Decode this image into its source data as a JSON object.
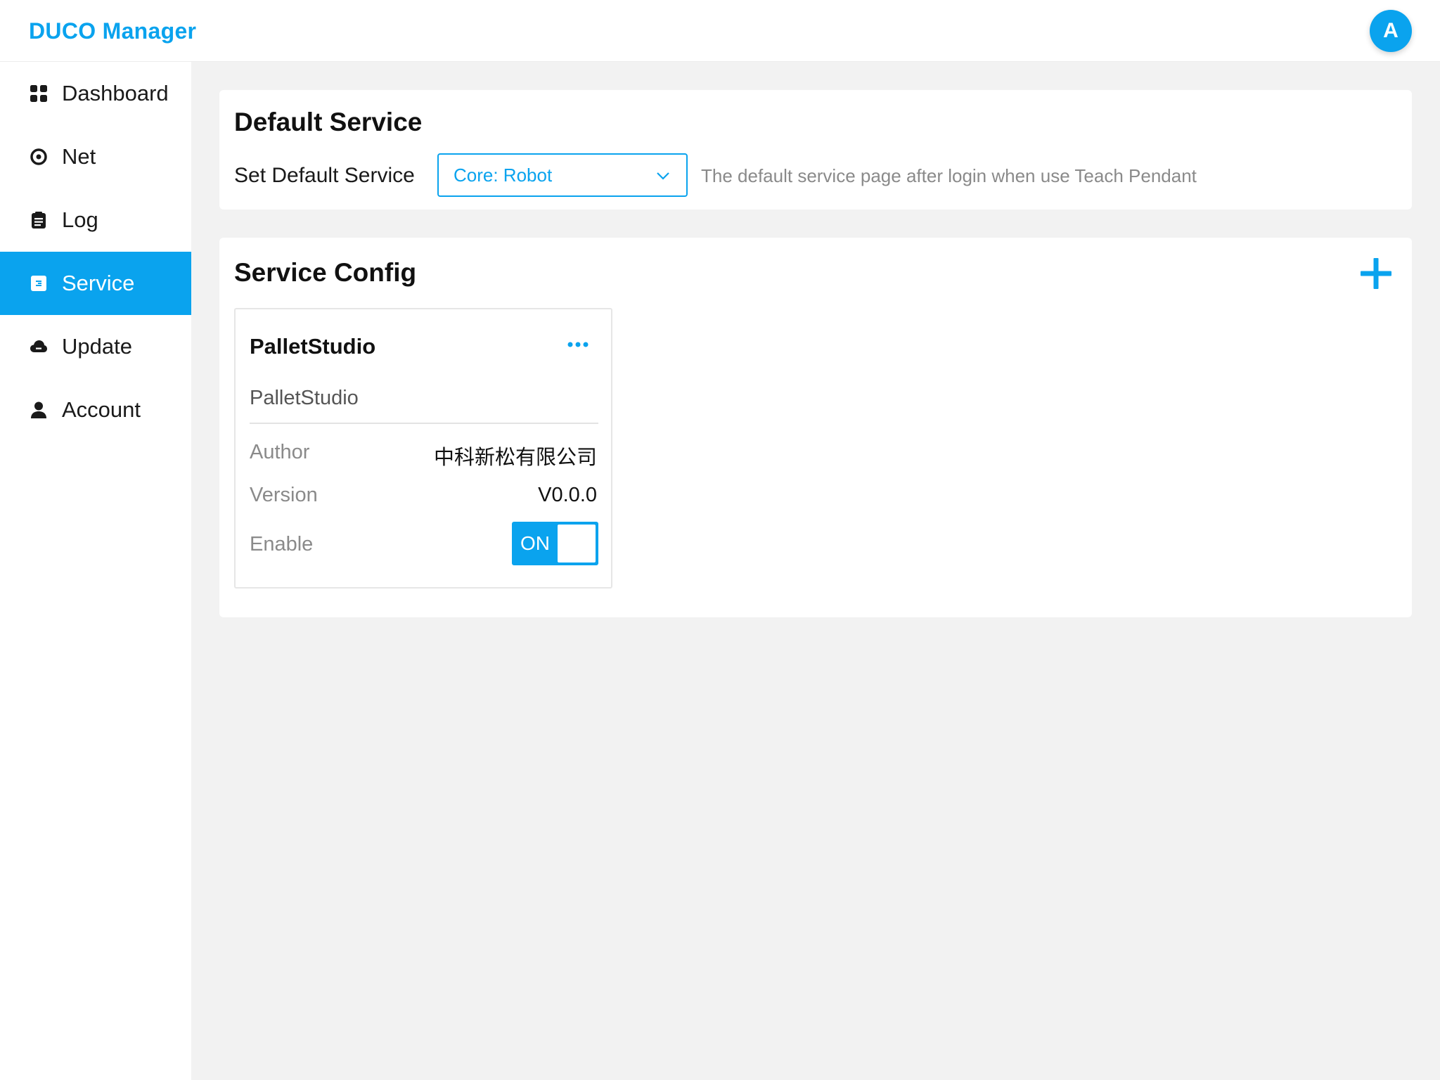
{
  "header": {
    "brand": "DUCO Manager",
    "avatar_initial": "A"
  },
  "sidebar": {
    "items": [
      {
        "label": "Dashboard",
        "icon": "dashboard-icon",
        "active": false
      },
      {
        "label": "Net",
        "icon": "net-icon",
        "active": false
      },
      {
        "label": "Log",
        "icon": "log-icon",
        "active": false
      },
      {
        "label": "Service",
        "icon": "service-icon",
        "active": true
      },
      {
        "label": "Update",
        "icon": "cloud-icon",
        "active": false
      },
      {
        "label": "Account",
        "icon": "user-icon",
        "active": false
      }
    ]
  },
  "default_service": {
    "title": "Default Service",
    "label": "Set Default Service",
    "selected": "Core: Robot",
    "hint": "The default service page after login when use Teach Pendant"
  },
  "service_config": {
    "title": "Service Config",
    "add_icon": "plus-icon",
    "cards": [
      {
        "title": "PalletStudio",
        "subtitle": "PalletStudio",
        "author_label": "Author",
        "author": "中科新松有限公司",
        "version_label": "Version",
        "version": "V0.0.0",
        "enable_label": "Enable",
        "toggle_text": "ON",
        "enabled": true
      }
    ]
  },
  "colors": {
    "accent": "#0aa3ee",
    "background": "#f2f2f2",
    "muted_text": "#8a8a8a"
  }
}
